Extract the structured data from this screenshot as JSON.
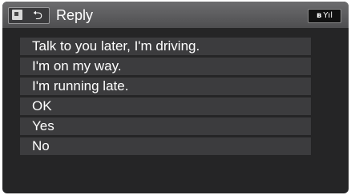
{
  "header": {
    "title": "Reply",
    "icons": [
      "phone-icon",
      "back-icon",
      "bluetooth-icon",
      "signal-icon"
    ],
    "back_glyph": "⮌",
    "status_bt": "ʙ",
    "status_signal": "Yıl"
  },
  "replies": [
    "Talk to you later, I'm driving.",
    "I'm on my way.",
    "I'm running late.",
    "OK",
    "Yes",
    "No"
  ]
}
